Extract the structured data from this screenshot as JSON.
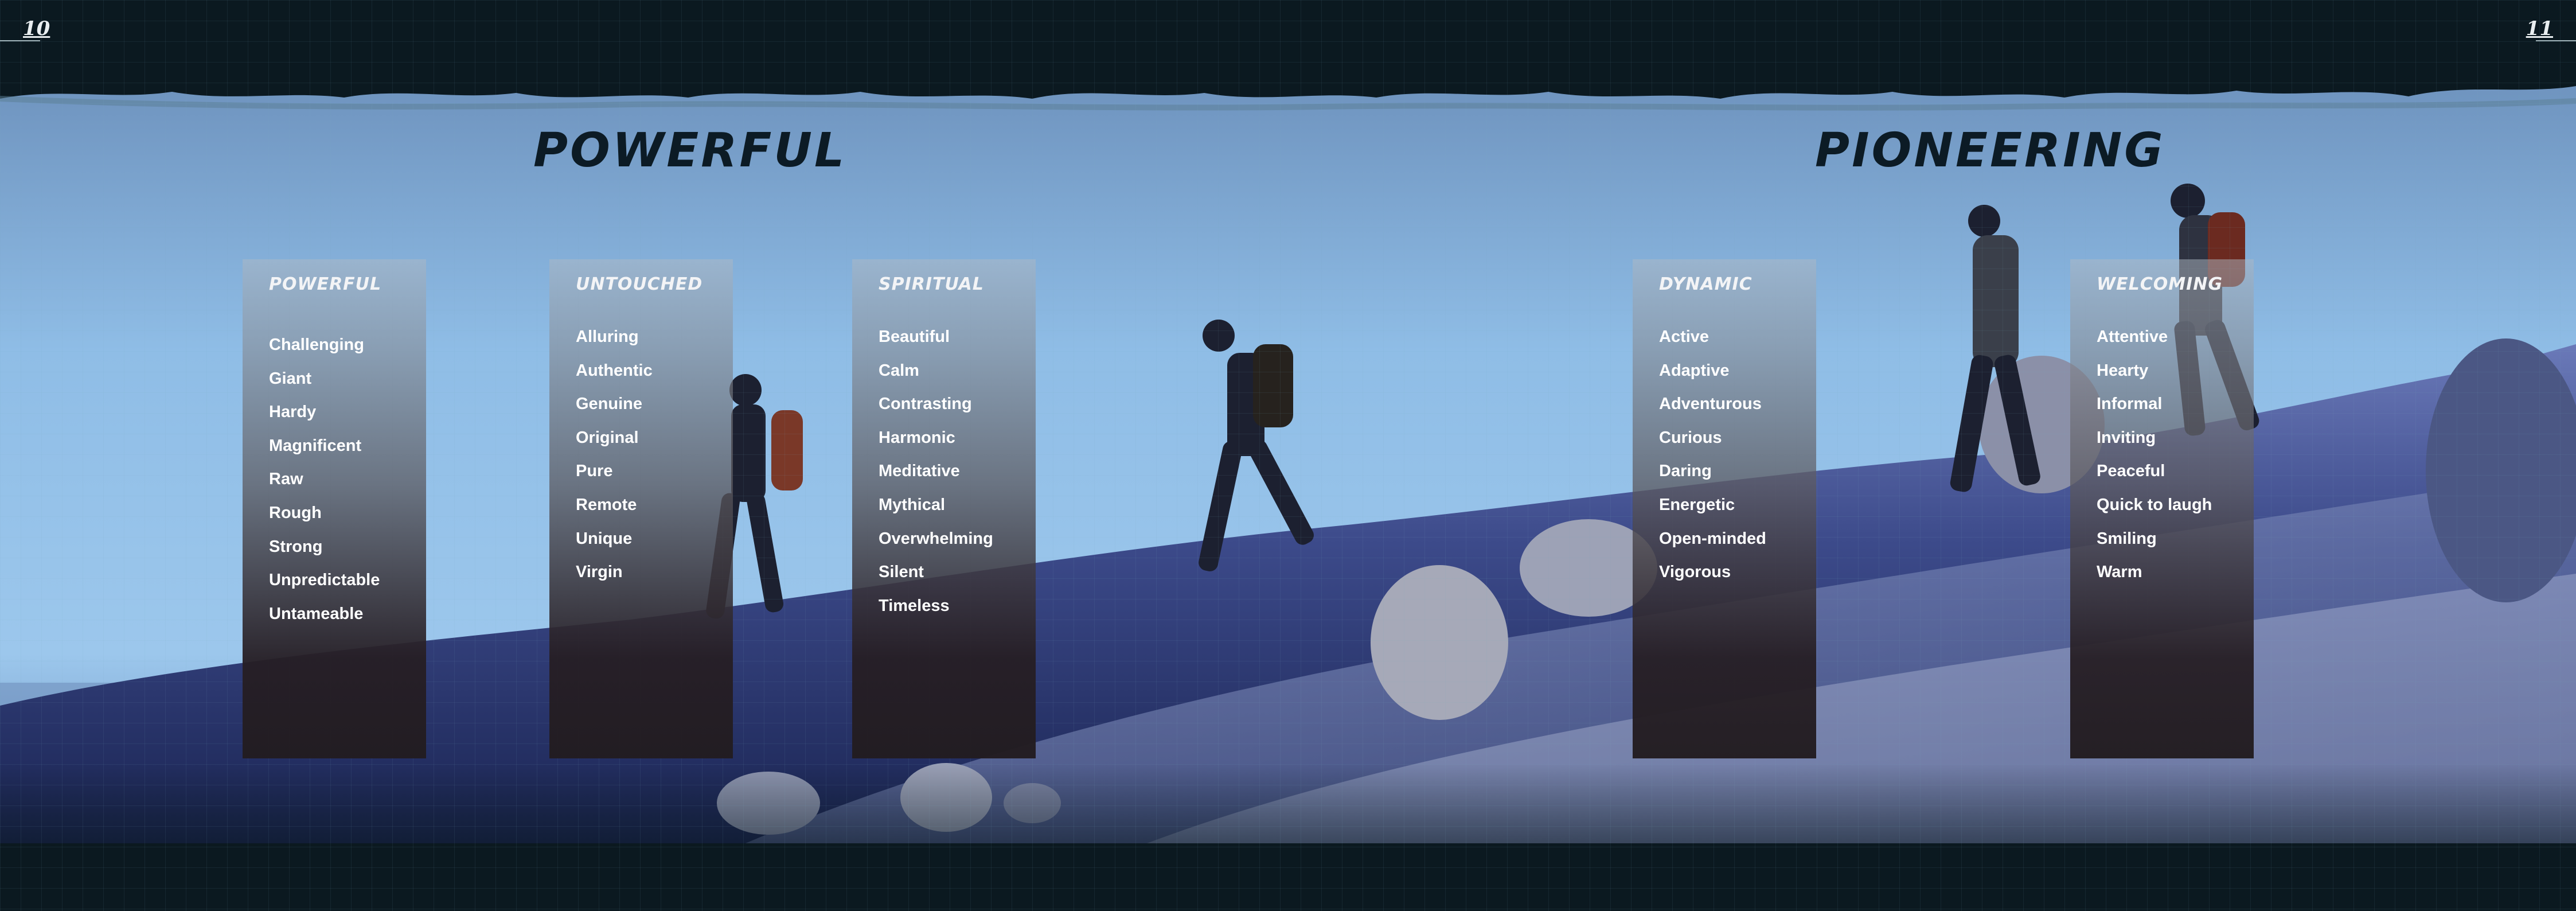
{
  "pages": {
    "left_number": "10",
    "right_number": "11"
  },
  "headings": {
    "left": "POWERFUL",
    "right": "PIONEERING"
  },
  "cards": [
    {
      "title": "POWERFUL",
      "items": [
        "Challenging",
        "Giant",
        "Hardy",
        "Magnificent",
        "Raw",
        "Rough",
        "Strong",
        "Unpredictable",
        "Untameable"
      ]
    },
    {
      "title": "UNTOUCHED",
      "items": [
        "Alluring",
        "Authentic",
        "Genuine",
        "Original",
        "Pure",
        "Remote",
        "Unique",
        "Virgin"
      ]
    },
    {
      "title": "SPIRITUAL",
      "items": [
        "Beautiful",
        "Calm",
        "Contrasting",
        "Harmonic",
        "Meditative",
        "Mythical",
        "Overwhelming",
        "Silent",
        "Timeless"
      ]
    },
    {
      "title": "DYNAMIC",
      "items": [
        "Active",
        "Adaptive",
        "Adventurous",
        "Curious",
        "Daring",
        "Energetic",
        "Open-minded",
        "Vigorous"
      ]
    },
    {
      "title": "WELCOMING",
      "items": [
        "Attentive",
        "Hearty",
        "Informal",
        "Inviting",
        "Peaceful",
        "Quick to laugh",
        "Smiling",
        "Warm"
      ]
    }
  ]
}
